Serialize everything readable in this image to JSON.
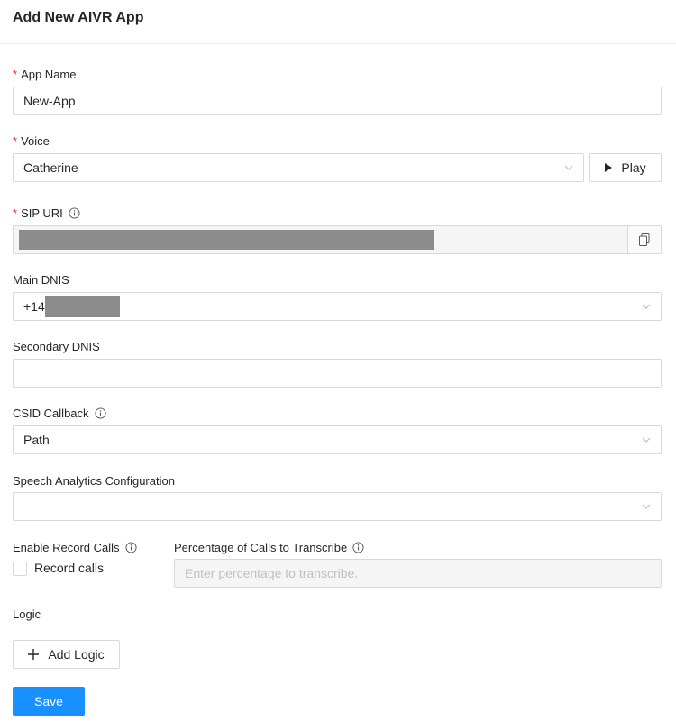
{
  "header": {
    "title": "Add New AIVR App"
  },
  "form": {
    "app_name": {
      "label": "App Name",
      "value": "New-App"
    },
    "voice": {
      "label": "Voice",
      "value": "Catherine",
      "play_label": "Play"
    },
    "sip_uri": {
      "label": "SIP URI"
    },
    "main_dnis": {
      "label": "Main DNIS",
      "value_prefix": "+14"
    },
    "secondary_dnis": {
      "label": "Secondary DNIS",
      "value": ""
    },
    "csid_callback": {
      "label": "CSID Callback",
      "value": "Path"
    },
    "speech_analytics": {
      "label": "Speech Analytics Configuration",
      "value": ""
    },
    "record_calls": {
      "label": "Enable Record Calls",
      "checkbox_label": "Record calls",
      "checked": false
    },
    "transcribe": {
      "label": "Percentage of Calls to Transcribe",
      "placeholder": "Enter percentage to transcribe."
    },
    "logic": {
      "label": "Logic",
      "add_label": "Add Logic"
    },
    "save_label": "Save"
  },
  "colors": {
    "primary": "#1890ff",
    "required": "#f5222d",
    "border": "#d9d9d9"
  }
}
